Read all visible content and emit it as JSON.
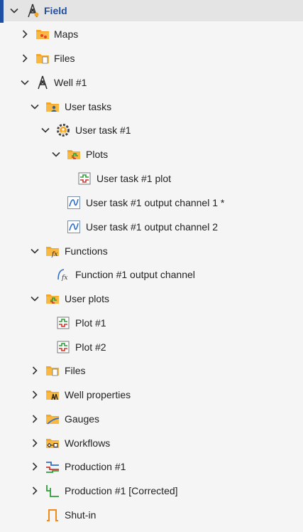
{
  "tree": {
    "field_label": "Field",
    "maps_label": "Maps",
    "files_top_label": "Files",
    "well_label": "Well #1",
    "user_tasks_label": "User tasks",
    "user_task_1_label": "User task #1",
    "plots_label": "Plots",
    "user_task_plot_label": "User task #1 plot",
    "output_channel_1_label": "User task #1 output channel 1 *",
    "output_channel_2_label": "User task #1 output channel 2",
    "functions_label": "Functions",
    "function_channel_label": "Function #1 output channel",
    "user_plots_label": "User plots",
    "plot_1_label": "Plot #1",
    "plot_2_label": "Plot #2",
    "files_well_label": "Files",
    "well_properties_label": "Well properties",
    "gauges_label": "Gauges",
    "workflows_label": "Workflows",
    "production_label": "Production #1",
    "production_corrected_label": "Production #1 [Corrected]",
    "shutin_label": "Shut-in"
  },
  "colors": {
    "accent": "#1f4fa3",
    "folder": "#f5a623",
    "selected_row": "#e4e4e4"
  }
}
